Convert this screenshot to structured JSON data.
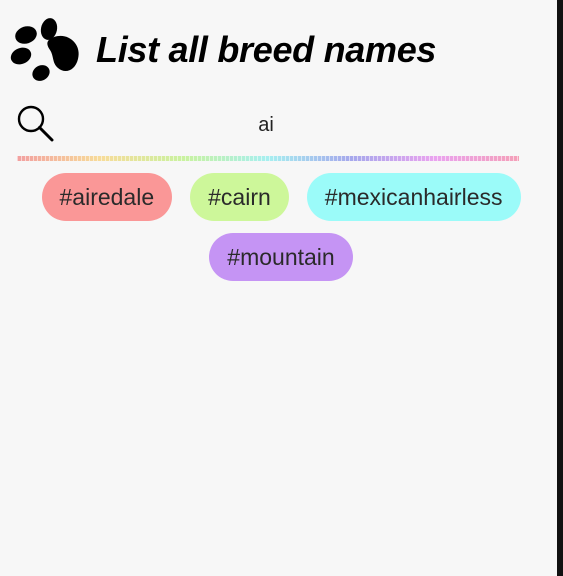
{
  "header": {
    "title": "List all breed names",
    "logo_icon": "paw-icon"
  },
  "search": {
    "icon": "search-icon",
    "value": "ai"
  },
  "divider": {
    "colors": [
      "#f2a0a0",
      "#f7dc9a",
      "#c9f2a0",
      "#a7eff0",
      "#a6a8ec",
      "#eaa3ef",
      "#f4a0b8"
    ]
  },
  "results": [
    {
      "label": "#airedale",
      "color": "#fa9797"
    },
    {
      "label": "#cairn",
      "color": "#cdf79a"
    },
    {
      "label": "#mexicanhairless",
      "color": "#9bfbf9"
    },
    {
      "label": "#mountain",
      "color": "#c594f4"
    }
  ]
}
